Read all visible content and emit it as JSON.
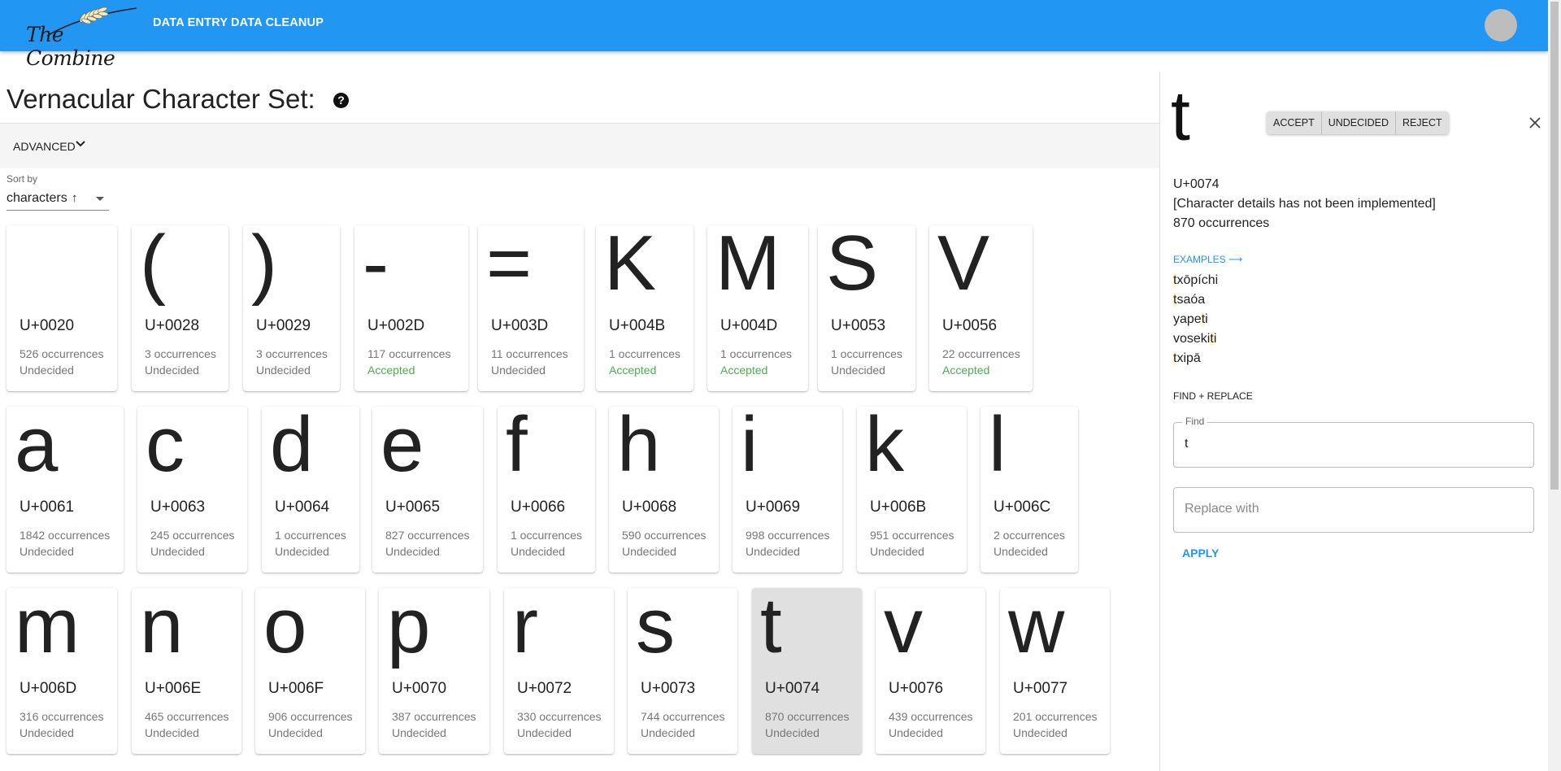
{
  "appbar": {
    "logo_text": "The Combine",
    "nav": [
      "DATA ENTRY",
      "DATA CLEANUP"
    ]
  },
  "main": {
    "title": "Vernacular Character Set:",
    "help_icon": "?",
    "advanced_label": "ADVANCED",
    "sort": {
      "label": "Sort by",
      "value": "characters",
      "direction": "ascending",
      "arrow": "↑"
    }
  },
  "cards": [
    {
      "char": " ",
      "code": "U+0020",
      "count": "526 occurrences",
      "status": "Undecided"
    },
    {
      "char": "(",
      "code": "U+0028",
      "count": "3 occurrences",
      "status": "Undecided"
    },
    {
      "char": ")",
      "code": "U+0029",
      "count": "3 occurrences",
      "status": "Undecided"
    },
    {
      "char": "-",
      "code": "U+002D",
      "count": "117 occurrences",
      "status": "Accepted"
    },
    {
      "char": "=",
      "code": "U+003D",
      "count": "11 occurrences",
      "status": "Undecided"
    },
    {
      "char": "K",
      "code": "U+004B",
      "count": "1 occurrences",
      "status": "Accepted"
    },
    {
      "char": "M",
      "code": "U+004D",
      "count": "1 occurrences",
      "status": "Accepted"
    },
    {
      "char": "S",
      "code": "U+0053",
      "count": "1 occurrences",
      "status": "Undecided"
    },
    {
      "char": "V",
      "code": "U+0056",
      "count": "22 occurrences",
      "status": "Accepted"
    },
    {
      "char": "a",
      "code": "U+0061",
      "count": "1842 occurrences",
      "status": "Undecided"
    },
    {
      "char": "c",
      "code": "U+0063",
      "count": "245 occurrences",
      "status": "Undecided"
    },
    {
      "char": "d",
      "code": "U+0064",
      "count": "1 occurrences",
      "status": "Undecided"
    },
    {
      "char": "e",
      "code": "U+0065",
      "count": "827 occurrences",
      "status": "Undecided"
    },
    {
      "char": "f",
      "code": "U+0066",
      "count": "1 occurrences",
      "status": "Undecided"
    },
    {
      "char": "h",
      "code": "U+0068",
      "count": "590 occurrences",
      "status": "Undecided"
    },
    {
      "char": "i",
      "code": "U+0069",
      "count": "998 occurrences",
      "status": "Undecided"
    },
    {
      "char": "k",
      "code": "U+006B",
      "count": "951 occurrences",
      "status": "Undecided"
    },
    {
      "char": "l",
      "code": "U+006C",
      "count": "2 occurrences",
      "status": "Undecided"
    },
    {
      "char": "m",
      "code": "U+006D",
      "count": "316 occurrences",
      "status": "Undecided"
    },
    {
      "char": "n",
      "code": "U+006E",
      "count": "465 occurrences",
      "status": "Undecided"
    },
    {
      "char": "o",
      "code": "U+006F",
      "count": "906 occurrences",
      "status": "Undecided"
    },
    {
      "char": "p",
      "code": "U+0070",
      "count": "387 occurrences",
      "status": "Undecided"
    },
    {
      "char": "r",
      "code": "U+0072",
      "count": "330 occurrences",
      "status": "Undecided"
    },
    {
      "char": "s",
      "code": "U+0073",
      "count": "744 occurrences",
      "status": "Undecided"
    },
    {
      "char": "t",
      "code": "U+0074",
      "count": "870 occurrences",
      "status": "Undecided",
      "selected": true
    },
    {
      "char": "v",
      "code": "U+0076",
      "count": "439 occurrences",
      "status": "Undecided"
    },
    {
      "char": "w",
      "code": "U+0077",
      "count": "201 occurrences",
      "status": "Undecided"
    }
  ],
  "panel": {
    "char": "t",
    "buttons": {
      "accept": "ACCEPT",
      "undecided": "UNDECIDED",
      "reject": "REJECT"
    },
    "code": "U+0074",
    "details": "[Character details has not been implemented]",
    "count": "870 occurrences",
    "examples_label": "EXAMPLES ⟶",
    "examples": [
      {
        "first": "t",
        "rest": "xōpíchi"
      },
      {
        "first": "t",
        "rest": "saóa"
      },
      {
        "pre": "yape",
        "first": "t",
        "rest": "i"
      },
      {
        "pre": "voseki",
        "first": "t",
        "rest": "i"
      },
      {
        "first": "t",
        "rest": "xipā"
      }
    ],
    "find_replace_title": "FIND + REPLACE",
    "find_label": "Find",
    "find_value": "t",
    "replace_placeholder": "Replace with",
    "apply_label": "APPLY"
  },
  "colors": {
    "appbar": "#2196f3",
    "accepted": "#4caf50",
    "link": "#2196f3",
    "selected_card": "#e0e0e0"
  }
}
